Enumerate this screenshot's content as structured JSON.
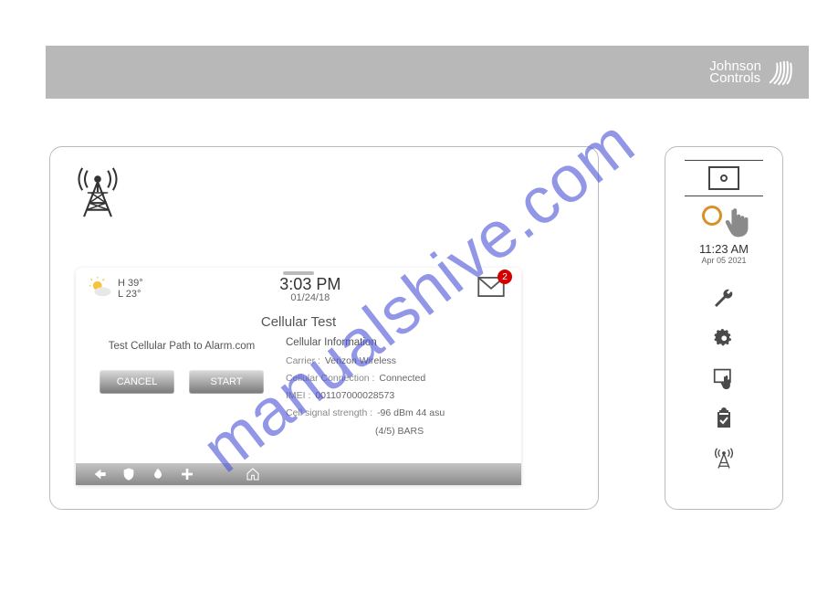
{
  "brand": {
    "line1": "Johnson",
    "line2": "Controls"
  },
  "panel": {
    "weather": {
      "high": "H 39°",
      "low": "L 23°"
    },
    "clock": {
      "time": "3:03 PM",
      "date": "01/24/18"
    },
    "messages_badge": "2",
    "screen_title": "Cellular Test",
    "subtitle": "Test Cellular Path to Alarm.com",
    "buttons": {
      "cancel": "CANCEL",
      "start": "START"
    },
    "info_title": "Cellular Information",
    "info": {
      "carrier_k": "Carrier :",
      "carrier_v": "Verizon Wireless",
      "conn_k": "Cellular Connection :",
      "conn_v": "Connected",
      "imei_k": "IMEI :",
      "imei_v": "001107000028573",
      "sig_k": "Cell signal strength :",
      "sig_v": "-96 dBm 44 asu",
      "sig_v2": "(4/5) BARS"
    }
  },
  "side": {
    "time": "11:23 AM",
    "date": "Apr 05 2021"
  },
  "watermark": "manualshive.com"
}
